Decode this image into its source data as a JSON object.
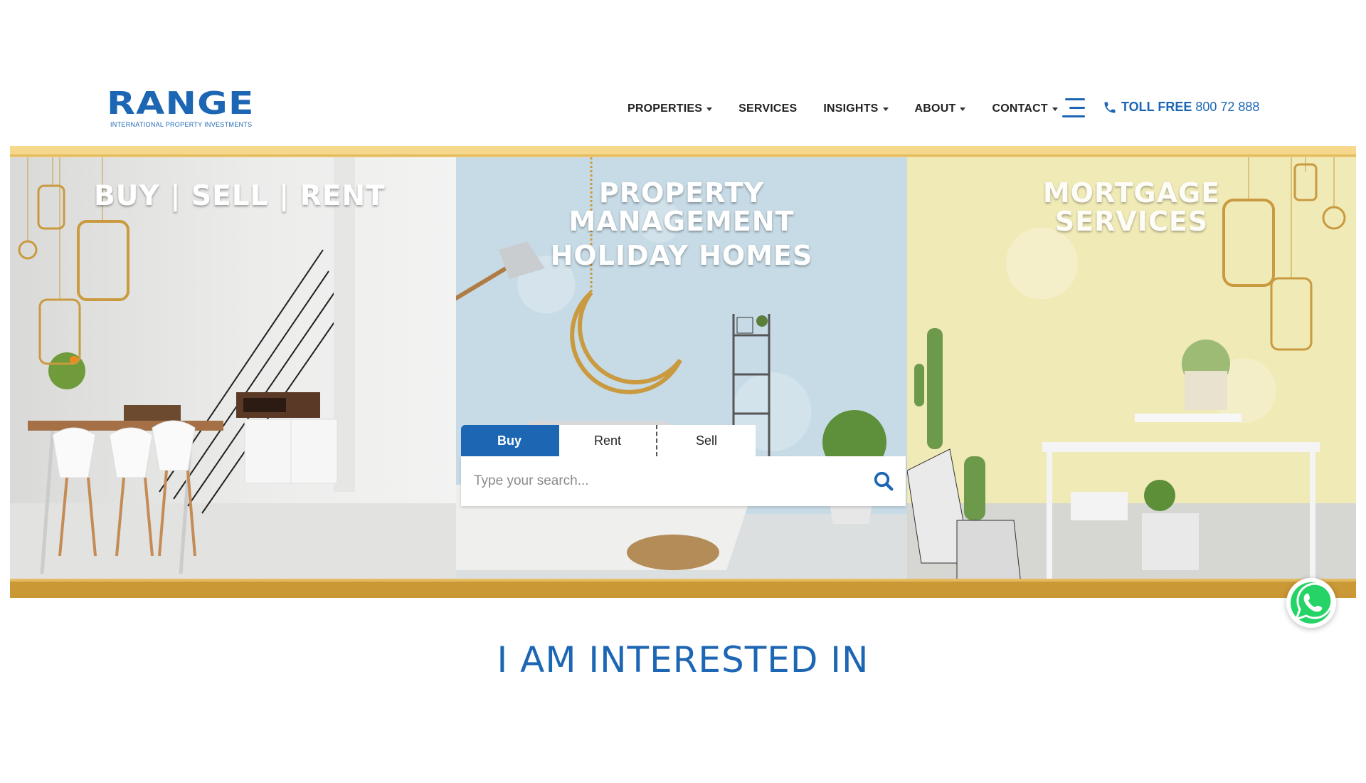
{
  "brand": {
    "logo_text": "RANGE",
    "tagline": "INTERNATIONAL PROPERTY INVESTMENTS",
    "color": "#1c66b4"
  },
  "nav": {
    "items": [
      {
        "label": "PROPERTIES",
        "dropdown": true
      },
      {
        "label": "SERVICES",
        "dropdown": false
      },
      {
        "label": "INSIGHTS",
        "dropdown": true
      },
      {
        "label": "ABOUT",
        "dropdown": true
      },
      {
        "label": "CONTACT",
        "dropdown": true
      }
    ],
    "menu_icon": "hamburger-icon",
    "toll_free_label": "TOLL FREE",
    "toll_free_number": "800 72 888"
  },
  "hero": {
    "panel1_title": "BUY | SELL | RENT",
    "panel2_title_line1": "PROPERTY",
    "panel2_title_line2": "MANAGEMENT",
    "panel2_title_line3": "HOLIDAY HOMES",
    "panel3_title_line1": "MORTGAGE",
    "panel3_title_line2": "SERVICES",
    "accent_gold": "#e4bb5e"
  },
  "search": {
    "tabs": [
      "Buy",
      "Rent",
      "Sell"
    ],
    "active_tab": "Buy",
    "placeholder": "Type your search...",
    "button_icon": "search-icon"
  },
  "floating": {
    "whatsapp_icon": "whatsapp-icon",
    "whatsapp_color": "#25d366"
  },
  "section": {
    "title": "I AM INTERESTED IN"
  }
}
